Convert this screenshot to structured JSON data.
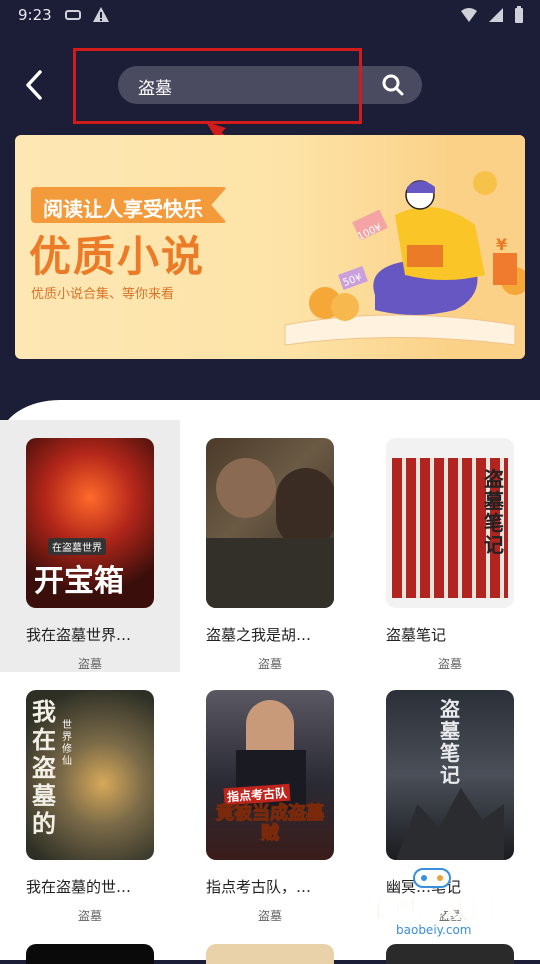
{
  "status": {
    "time": "9:23"
  },
  "search": {
    "query": "盗墓"
  },
  "banner": {
    "tag": "阅读让人享受快乐",
    "title": "优质小说",
    "subtitle": "优质小说合集、等你来看",
    "cover_badges": [
      "100¥",
      "50¥"
    ],
    "coin_symbol": "¥"
  },
  "books": [
    {
      "title": "我在盗墓世界…",
      "category": "盗墓",
      "cover_text": "开宝箱",
      "cover_sub": "在盗墓世界"
    },
    {
      "title": "盗墓之我是胡…",
      "category": "盗墓",
      "cover_text": "",
      "cover_sub": ""
    },
    {
      "title": "盗墓笔记",
      "category": "盗墓",
      "cover_text": "盗墓笔记",
      "cover_sub": ""
    },
    {
      "title": "我在盗墓的世…",
      "category": "盗墓",
      "cover_text": "我在盗墓的",
      "cover_sub": "世界修仙"
    },
    {
      "title": "指点考古队，…",
      "category": "盗墓",
      "cover_text": "竟被当成盗墓贼",
      "cover_sub": "指点考古队"
    },
    {
      "title": "幽冥…笔记",
      "category": "盗墓",
      "cover_text": "盗墓笔记",
      "cover_sub": ""
    }
  ],
  "watermark": {
    "text": "宝贝游戏网",
    "url": "baobeiy.com"
  }
}
